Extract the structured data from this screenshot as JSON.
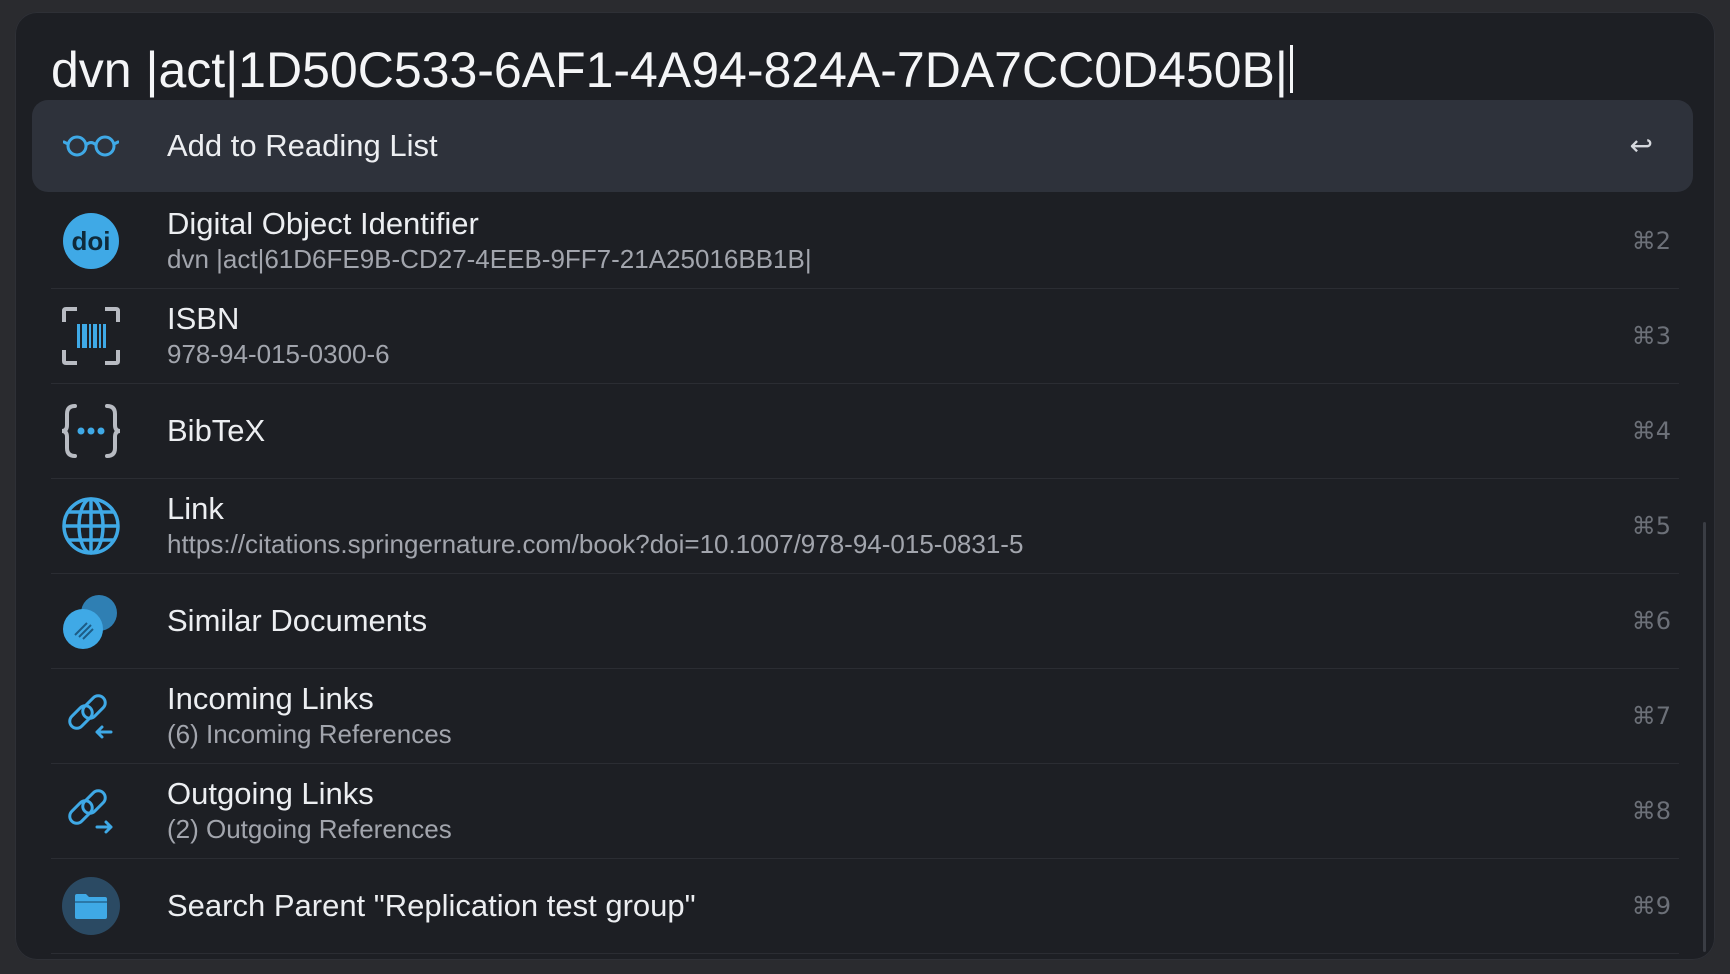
{
  "query": "dvn |act|1D50C533-6AF1-4A94-824A-7DA7CC0D450B|",
  "accent": "#3fa9e6",
  "items": [
    {
      "title": "Add to Reading List",
      "subtitle": "",
      "shortcut": "↩",
      "icon": "glasses-icon",
      "selected": true
    },
    {
      "title": "Digital Object Identifier",
      "subtitle": "dvn |act|61D6FE9B-CD27-4EEB-9FF7-21A25016BB1B|",
      "shortcut": "⌘2",
      "icon": "doi-icon"
    },
    {
      "title": "ISBN",
      "subtitle": "978-94-015-0300-6",
      "shortcut": "⌘3",
      "icon": "barcode-icon"
    },
    {
      "title": "BibTeX",
      "subtitle": "",
      "shortcut": "⌘4",
      "icon": "braces-icon"
    },
    {
      "title": "Link",
      "subtitle": "https://citations.springernature.com/book?doi=10.1007/978-94-015-0831-5",
      "shortcut": "⌘5",
      "icon": "globe-icon"
    },
    {
      "title": "Similar Documents",
      "subtitle": "",
      "shortcut": "⌘6",
      "icon": "similar-documents-icon"
    },
    {
      "title": "Incoming Links",
      "subtitle": "(6) Incoming References",
      "shortcut": "⌘7",
      "icon": "incoming-link-icon"
    },
    {
      "title": "Outgoing Links",
      "subtitle": "(2) Outgoing References",
      "shortcut": "⌘8",
      "icon": "outgoing-link-icon"
    },
    {
      "title": "Search Parent \"Replication test group\"",
      "subtitle": "",
      "shortcut": "⌘9",
      "icon": "folder-icon"
    }
  ]
}
